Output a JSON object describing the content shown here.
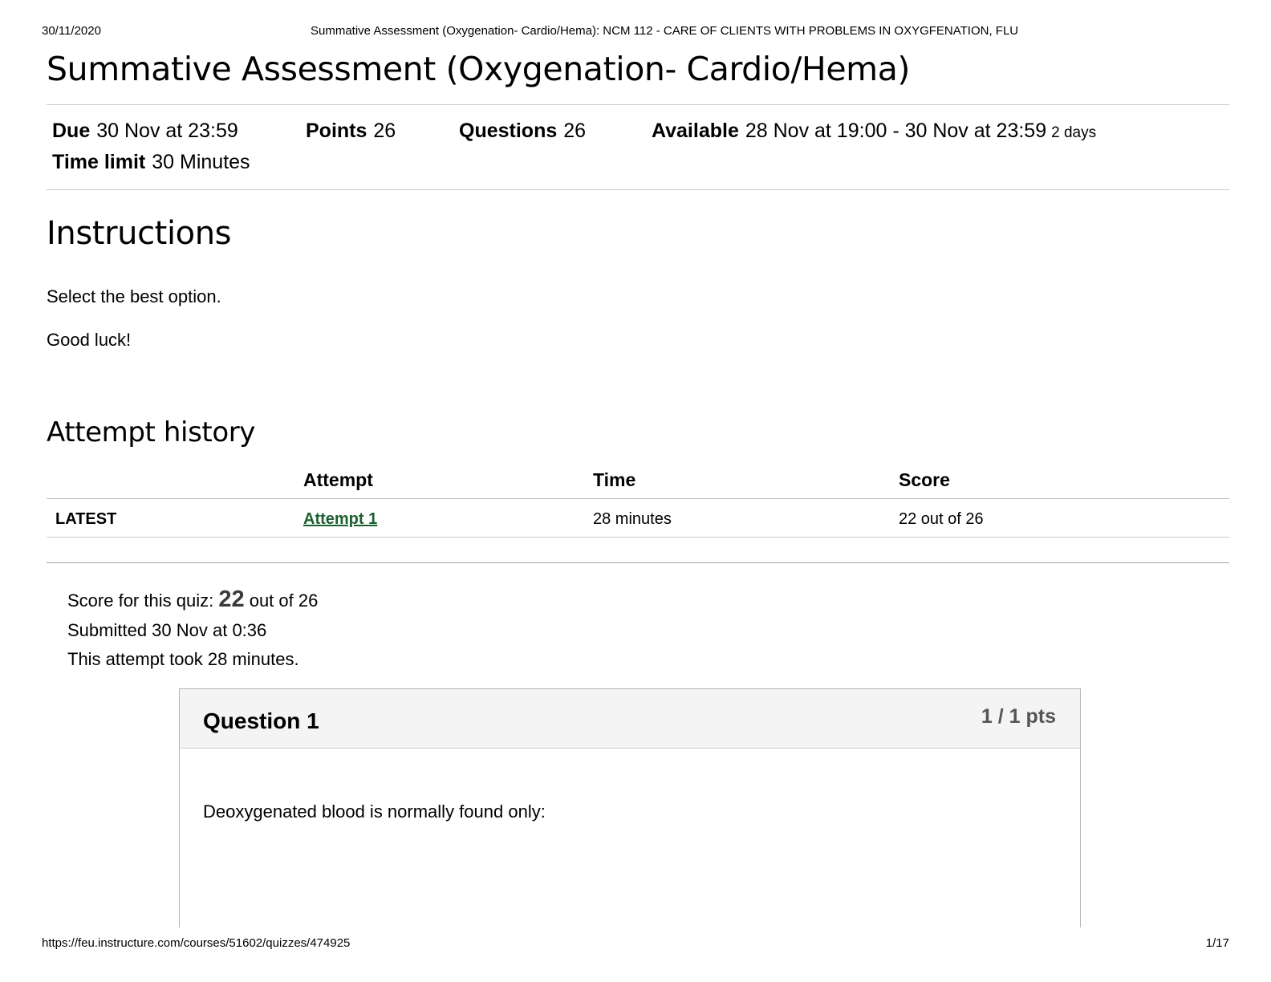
{
  "print": {
    "date": "30/11/2020",
    "title": "Summative Assessment (Oxygenation- Cardio/Hema): NCM 112 - CARE OF CLIENTS WITH PROBLEMS IN OXYGFENATION, FLU",
    "url": "https://feu.instructure.com/courses/51602/quizzes/474925",
    "page": "1/17"
  },
  "quiz": {
    "title": "Summative Assessment (Oxygenation- Cardio/Hema)",
    "due_label": "Due",
    "due_value": "30 Nov at 23:59",
    "points_label": "Points",
    "points_value": "26",
    "questions_label": "Questions",
    "questions_value": "26",
    "available_label": "Available",
    "available_value": "28 Nov at 19:00 - 30 Nov at 23:59",
    "available_duration": "2 days",
    "time_limit_label": "Time limit",
    "time_limit_value": "30 Minutes"
  },
  "instructions": {
    "heading": "Instructions",
    "line1": "Select the best option.",
    "line2": "Good luck!"
  },
  "attempt_history": {
    "heading": "Attempt history",
    "columns": [
      "Attempt",
      "Time",
      "Score"
    ],
    "rows": [
      {
        "tag": "LATEST",
        "attempt": "Attempt 1",
        "time": "28 minutes",
        "score": "22 out of 26"
      }
    ]
  },
  "summary": {
    "score_prefix": "Score for this quiz:",
    "score_value": "22",
    "score_suffix": "out of 26",
    "submitted": "Submitted 30 Nov at 0:36",
    "duration": "This attempt took 28 minutes."
  },
  "question": {
    "title": "Question 1",
    "points": "1 / 1 pts",
    "text": "Deoxygenated blood is normally found only:"
  }
}
